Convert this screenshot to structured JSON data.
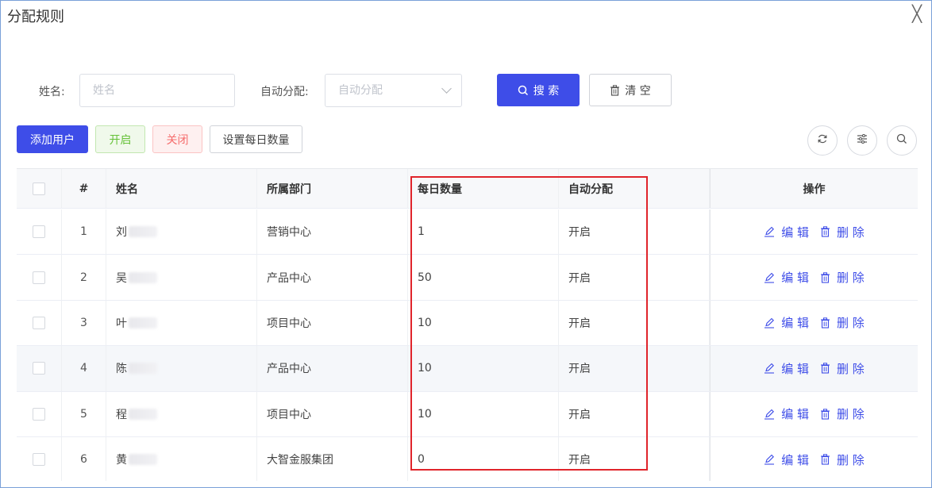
{
  "dialog": {
    "title": "分配规则",
    "close_glyph": "╳"
  },
  "filters": {
    "name_label": "姓名:",
    "name_placeholder": "姓名",
    "auto_label": "自动分配:",
    "auto_placeholder": "自动分配",
    "search_label": "搜 索",
    "clear_label": "清 空"
  },
  "toolbar": {
    "add_user": "添加用户",
    "enable": "开启",
    "disable": "关闭",
    "set_daily": "设置每日数量"
  },
  "table": {
    "headers": [
      "#",
      "姓名",
      "所属部门",
      "每日数量",
      "自动分配",
      "操作"
    ],
    "rows": [
      {
        "index": "1",
        "name": "刘",
        "dept": "营销中心",
        "daily": "1",
        "auto": "开启"
      },
      {
        "index": "2",
        "name": "吴",
        "dept": "产品中心",
        "daily": "50",
        "auto": "开启"
      },
      {
        "index": "3",
        "name": "叶",
        "dept": "项目中心",
        "daily": "10",
        "auto": "开启"
      },
      {
        "index": "4",
        "name": "陈",
        "dept": "产品中心",
        "daily": "10",
        "auto": "开启"
      },
      {
        "index": "5",
        "name": "程",
        "dept": "项目中心",
        "daily": "10",
        "auto": "开启"
      },
      {
        "index": "6",
        "name": "黄",
        "dept": "大智金服集团",
        "daily": "0",
        "auto": "开启"
      }
    ],
    "edit_label": "编 辑",
    "delete_label": "删 除"
  },
  "colors": {
    "primary": "#3e4de8",
    "highlight": "#e0242b",
    "enable_green": "#67c23a",
    "disable_red": "#f56c6c"
  },
  "icons": [
    "close-icon",
    "search-icon",
    "trash-icon",
    "refresh-icon",
    "filter-settings-icon",
    "edit-icon",
    "chevron-down-icon"
  ]
}
